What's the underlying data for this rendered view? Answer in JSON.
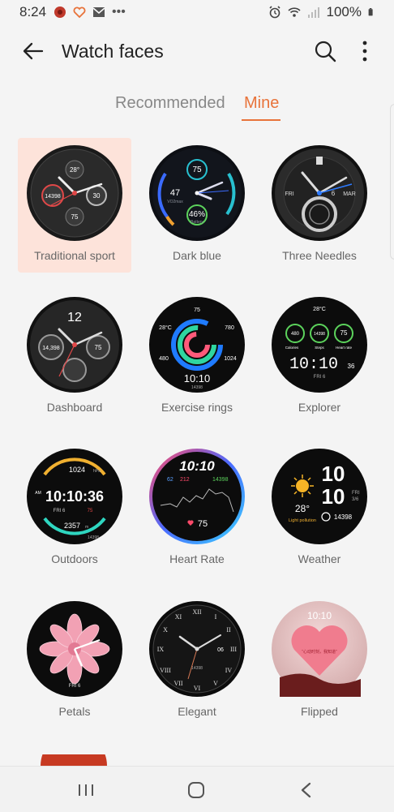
{
  "status_bar": {
    "time": "8:24",
    "battery": "100%"
  },
  "header": {
    "title": "Watch faces"
  },
  "tabs": [
    {
      "label": "Recommended",
      "active": false
    },
    {
      "label": "Mine",
      "active": true
    }
  ],
  "accent_color": "#e8733a",
  "faces": [
    {
      "name": "Traditional sport",
      "selected": true,
      "texts": [
        "28°",
        "14398",
        "30",
        "75"
      ]
    },
    {
      "name": "Dark blue",
      "selected": false,
      "texts": [
        "75",
        "47",
        "VO2max",
        "46%",
        "Battery"
      ]
    },
    {
      "name": "Three Needles",
      "selected": false,
      "texts": [
        "FRI",
        "6",
        "MAR"
      ]
    },
    {
      "name": "Dashboard",
      "selected": false,
      "texts": [
        "12",
        "14,398",
        "75"
      ]
    },
    {
      "name": "Exercise rings",
      "selected": false,
      "texts": [
        "75",
        "28°C",
        "780",
        "480",
        "1024",
        "10:10",
        "14398"
      ]
    },
    {
      "name": "Explorer",
      "selected": false,
      "texts": [
        "28°C",
        "480",
        "14398",
        "75",
        "Calories",
        "Steps",
        "Heart rate",
        "10:10",
        "36",
        "FRI 6"
      ]
    },
    {
      "name": "Outdoors",
      "selected": false,
      "texts": [
        "1024",
        "hPa",
        "AM",
        "10:10:36",
        "FRI 6",
        "75",
        "2357",
        "m",
        "14398"
      ]
    },
    {
      "name": "Heart Rate",
      "selected": false,
      "texts": [
        "10:10",
        "62",
        "212",
        "14398",
        "75"
      ]
    },
    {
      "name": "Weather",
      "selected": false,
      "texts": [
        "10",
        "10",
        "FRI",
        "3/6",
        "28°",
        "Light pollution",
        "14398"
      ]
    },
    {
      "name": "Petals",
      "selected": false,
      "texts": [
        "FRI 6"
      ]
    },
    {
      "name": "Elegant",
      "selected": false,
      "texts": [
        "06",
        "14398"
      ]
    },
    {
      "name": "Flipped",
      "selected": false,
      "texts": [
        "10:10",
        "“心动时刻，我知道”"
      ]
    }
  ]
}
